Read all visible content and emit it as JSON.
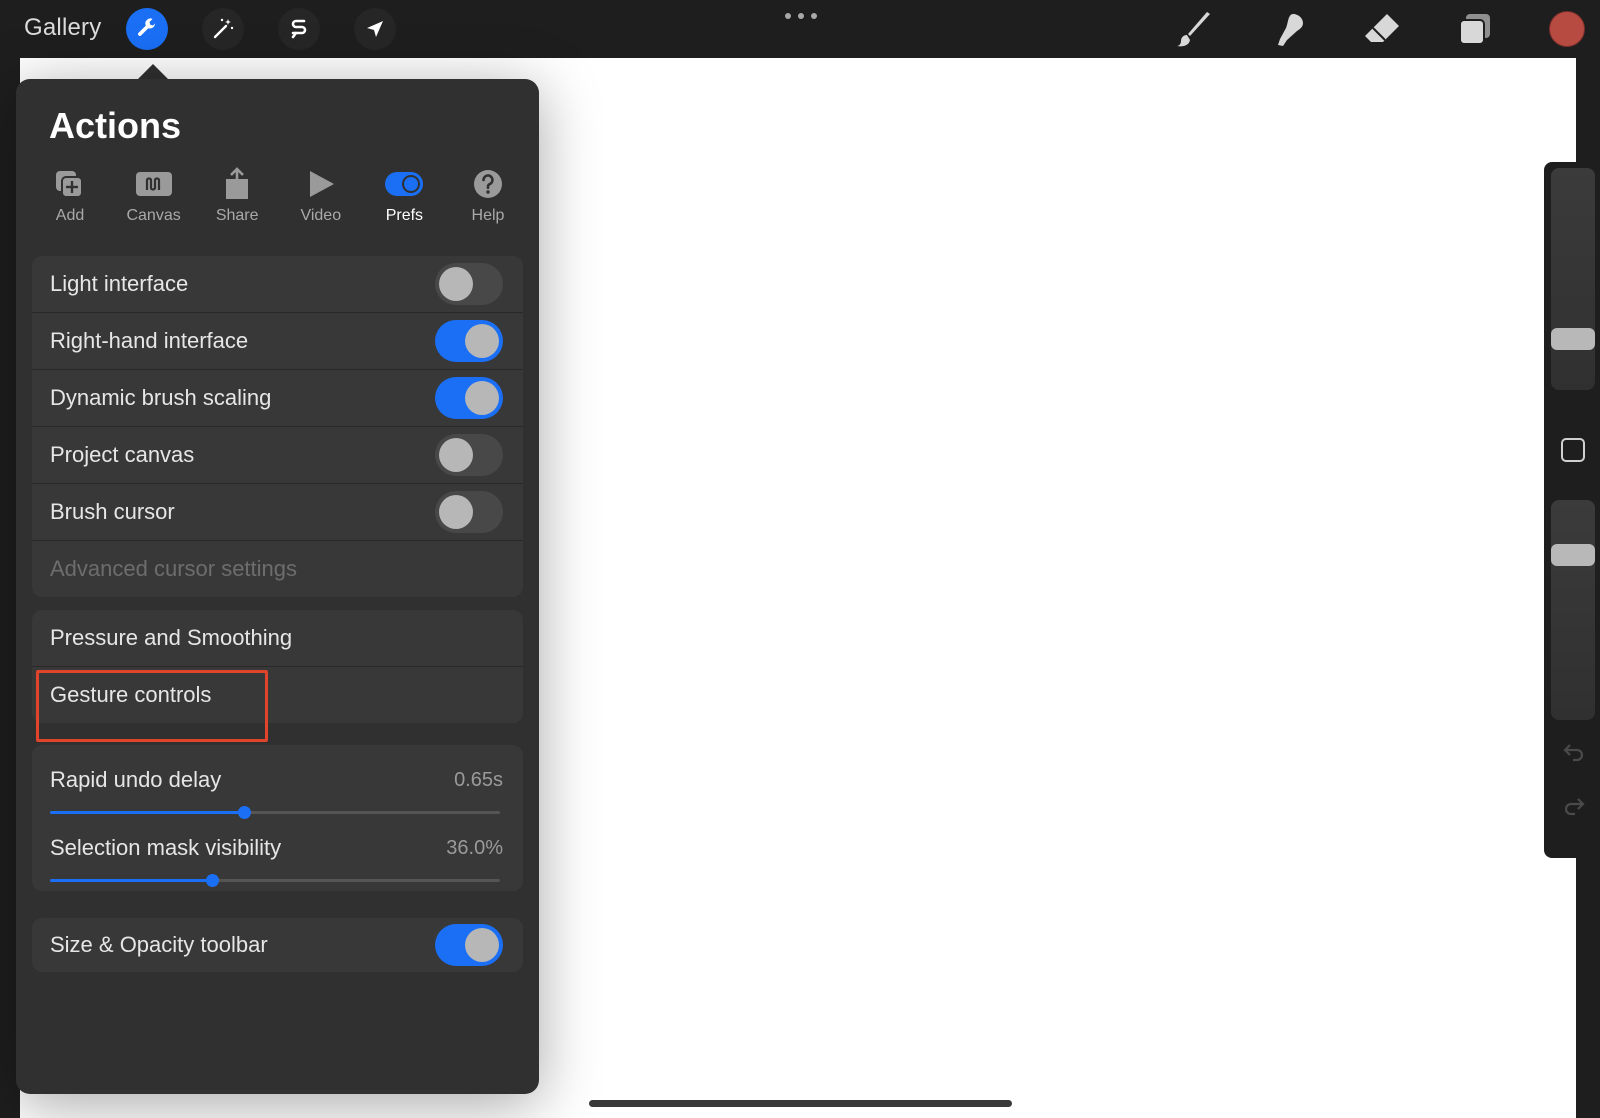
{
  "toolbar": {
    "gallery_label": "Gallery",
    "left_tools": [
      {
        "icon": "wrench-icon",
        "active": true
      },
      {
        "icon": "magic-wand-icon",
        "active": false
      },
      {
        "icon": "selection-s-icon",
        "active": false
      },
      {
        "icon": "transform-arrow-icon",
        "active": false
      }
    ],
    "right_tools": [
      "brush-icon",
      "smudge-icon",
      "eraser-icon",
      "layers-icon"
    ],
    "current_color": "#b84b41",
    "accent_color": "#1a6ff5"
  },
  "panel": {
    "title": "Actions",
    "tabs": [
      {
        "label": "Add",
        "icon": "add-icon",
        "active": false
      },
      {
        "label": "Canvas",
        "icon": "canvas-icon",
        "active": false
      },
      {
        "label": "Share",
        "icon": "share-icon",
        "active": false
      },
      {
        "label": "Video",
        "icon": "play-icon",
        "active": false
      },
      {
        "label": "Prefs",
        "icon": "toggle-icon",
        "active": true
      },
      {
        "label": "Help",
        "icon": "help-icon",
        "active": false
      }
    ],
    "interface_group": [
      {
        "label": "Light interface",
        "toggle": false
      },
      {
        "label": "Right-hand interface",
        "toggle": true
      },
      {
        "label": "Dynamic brush scaling",
        "toggle": true
      },
      {
        "label": "Project canvas",
        "toggle": false
      },
      {
        "label": "Brush cursor",
        "toggle": false
      },
      {
        "label": "Advanced cursor settings",
        "disabled": true
      }
    ],
    "controls_group": [
      {
        "label": "Pressure and Smoothing"
      },
      {
        "label": "Gesture controls",
        "highlighted": true
      }
    ],
    "sliders_group": [
      {
        "label": "Rapid undo delay",
        "value": "0.65s",
        "fraction": 0.43
      },
      {
        "label": "Selection mask visibility",
        "value": "36.0%",
        "fraction": 0.36
      }
    ],
    "toolbar_group": [
      {
        "label": "Size & Opacity toolbar",
        "toggle": true
      }
    ]
  },
  "sidebar": {
    "brush_size_fraction": 0.2,
    "opacity_fraction": 0.22
  }
}
